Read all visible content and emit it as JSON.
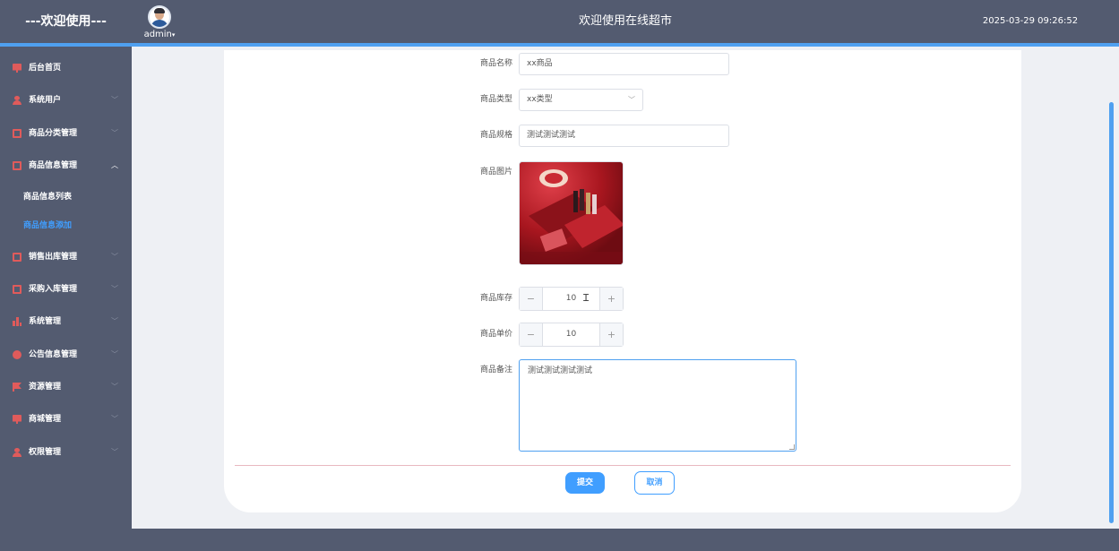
{
  "header": {
    "welcome": "---欢迎使用---",
    "username": "admin",
    "title": "欢迎使用在线超市",
    "datetime": "2025-03-29 09:26:52"
  },
  "sidebar": {
    "items": [
      {
        "label": "后台首页",
        "icon": "monitor-icon"
      },
      {
        "label": "系统用户",
        "icon": "user-icon"
      },
      {
        "label": "商品分类管理",
        "icon": "chart-icon"
      },
      {
        "label": "商品信息管理",
        "icon": "chart-icon",
        "expanded": true
      },
      {
        "label": "销售出库管理",
        "icon": "chart-icon"
      },
      {
        "label": "采购入库管理",
        "icon": "chart-icon"
      },
      {
        "label": "系统管理",
        "icon": "bar-chart-icon"
      },
      {
        "label": "公告信息管理",
        "icon": "alert-icon"
      },
      {
        "label": "资源管理",
        "icon": "flag-icon"
      },
      {
        "label": "商城管理",
        "icon": "monitor-icon"
      },
      {
        "label": "权限管理",
        "icon": "user-icon"
      }
    ],
    "sub_items": [
      {
        "label": "商品信息列表",
        "active": false
      },
      {
        "label": "商品信息添加",
        "active": true
      }
    ]
  },
  "form": {
    "name_label": "商品名称",
    "name_value": "xx商品",
    "type_label": "商品类型",
    "type_value": "xx类型",
    "spec_label": "商品规格",
    "spec_value": "测试测试测试",
    "image_label": "商品图片",
    "stock_label": "商品库存",
    "stock_value": "10",
    "price_label": "商品单价",
    "price_value": "10",
    "remark_label": "商品备注",
    "remark_value": "测试测试测试测试",
    "minus": "−",
    "plus": "+",
    "submit": "提交",
    "cancel": "取消"
  },
  "colors": {
    "header_bg": "#535b70",
    "accent": "#409eff",
    "icon": "#e05b5b"
  }
}
